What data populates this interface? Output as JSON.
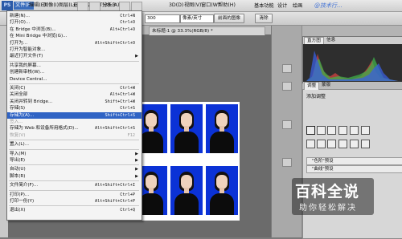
{
  "app": {
    "logo": "PS"
  },
  "menubar": {
    "items": [
      "文件(F)",
      "编辑(E)",
      "图像(I)",
      "图层(L)",
      "选择(S)",
      "滤镜(T)",
      "分析(A)",
      "3D(D)",
      "视图(V)",
      "窗口(W)",
      "帮助(H)"
    ],
    "zoom": "33.3",
    "right": [
      "基本功能",
      "设计",
      "绘画"
    ]
  },
  "options_bar": {
    "field_value": "300",
    "dropdown_value": "像素/英寸",
    "front_image_button": "前面的图像",
    "clear_button": "清除"
  },
  "document_tab": "未标题-1 @ 33.3%(RGB/8) *",
  "file_menu": {
    "groups": [
      [
        {
          "label": "新建(N)...",
          "shortcut": "Ctrl+N"
        },
        {
          "label": "打开(O)...",
          "shortcut": "Ctrl+O"
        },
        {
          "label": "在 Bridge 中浏览(B)...",
          "shortcut": "Alt+Ctrl+O"
        },
        {
          "label": "在 Mini Bridge 中浏览(G)...",
          "shortcut": ""
        },
        {
          "label": "打开为...",
          "shortcut": "Alt+Shift+Ctrl+O"
        },
        {
          "label": "打开为智能对象...",
          "shortcut": ""
        },
        {
          "label": "最近打开文件(T)",
          "shortcut": "",
          "submenu": true
        }
      ],
      [
        {
          "label": "共享我的屏幕...",
          "shortcut": ""
        },
        {
          "label": "创建新审核(W)...",
          "shortcut": ""
        },
        {
          "label": "Device Central...",
          "shortcut": ""
        }
      ],
      [
        {
          "label": "关闭(C)",
          "shortcut": "Ctrl+W"
        },
        {
          "label": "关闭全部",
          "shortcut": "Alt+Ctrl+W"
        },
        {
          "label": "关闭并转到 Bridge...",
          "shortcut": "Shift+Ctrl+W"
        },
        {
          "label": "存储(S)",
          "shortcut": "Ctrl+S"
        },
        {
          "label": "存储为(A)...",
          "shortcut": "Shift+Ctrl+S",
          "highlighted": true
        },
        {
          "label": "签入...",
          "shortcut": "",
          "disabled": true
        },
        {
          "label": "存储为 Web 和设备所用格式(D)...",
          "shortcut": "Alt+Shift+Ctrl+S"
        },
        {
          "label": "恢复(V)",
          "shortcut": "F12",
          "disabled": true
        }
      ],
      [
        {
          "label": "置入(L)...",
          "shortcut": ""
        }
      ],
      [
        {
          "label": "导入(M)",
          "shortcut": "",
          "submenu": true
        },
        {
          "label": "导出(E)",
          "shortcut": "",
          "submenu": true
        }
      ],
      [
        {
          "label": "自动(U)",
          "shortcut": "",
          "submenu": true
        },
        {
          "label": "脚本(R)",
          "shortcut": "",
          "submenu": true
        }
      ],
      [
        {
          "label": "文件简介(F)...",
          "shortcut": "Alt+Shift+Ctrl+I"
        }
      ],
      [
        {
          "label": "打印(P)...",
          "shortcut": "Ctrl+P"
        },
        {
          "label": "打印一份(Y)",
          "shortcut": "Alt+Shift+Ctrl+P"
        }
      ],
      [
        {
          "label": "退出(X)",
          "shortcut": "Ctrl+Q"
        }
      ]
    ]
  },
  "histogram_panel": {
    "tabs": [
      "直方图",
      "信息"
    ]
  },
  "adjustments_panel": {
    "tabs": [
      "调整",
      "蒙版"
    ],
    "title": "添加调整",
    "presets": [
      "\"色阶\"预设",
      "\"曲线\"预设"
    ]
  },
  "watermark": {
    "main": "百科全说",
    "sub": "助你轻松解决",
    "top": "@技术行..."
  },
  "colors": {
    "photo_background": "#0b32d6",
    "menu_highlight": "#2f63c4"
  }
}
